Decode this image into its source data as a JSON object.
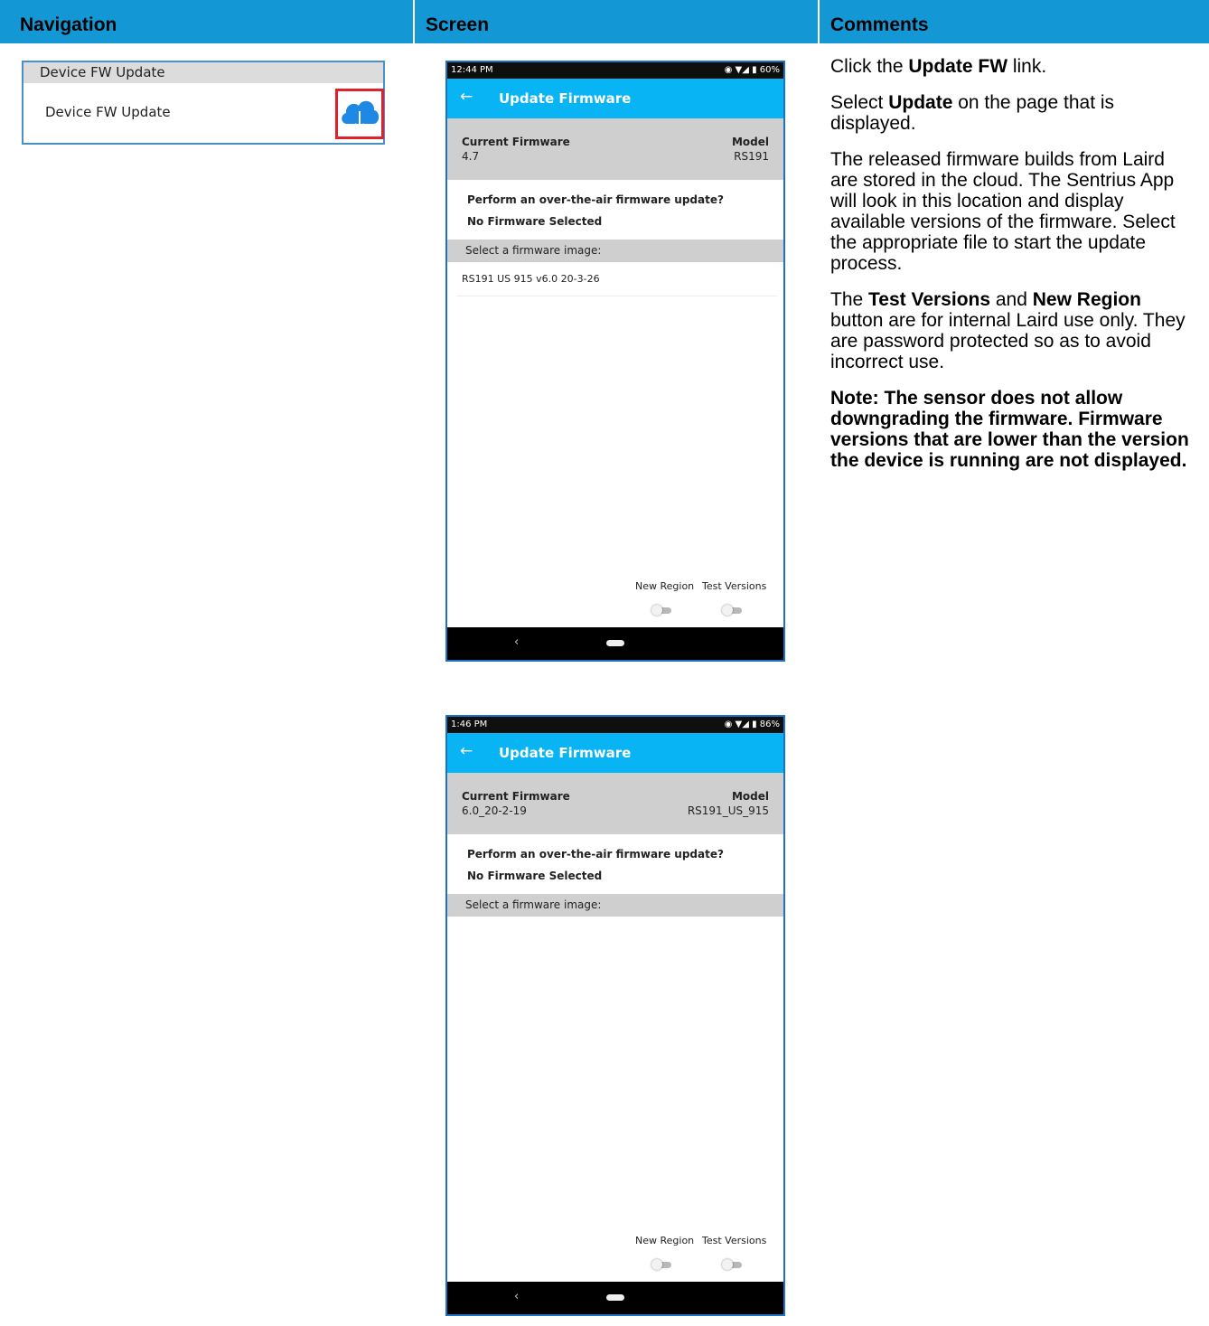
{
  "table_header": {
    "col1": "Navigation",
    "col2": "Screen",
    "col3": "Comments",
    "background": "#1498d5"
  },
  "navigation": {
    "heading": "Device FW Update",
    "item_label": "Device FW Update",
    "icon": "cloud-download-icon",
    "highlight_color": "#e0202a"
  },
  "screens": [
    {
      "status_time": "12:44 PM",
      "status_right": "◉ ▼◢ ▮ 60%",
      "title": "Update Firmware",
      "current_firmware_label": "Current Firmware",
      "current_firmware_value": "4.7",
      "model_label": "Model",
      "model_value": "RS191",
      "question": "Perform an over-the-air firmware update?",
      "no_selection": "No Firmware Selected",
      "select_prompt": "Select a firmware image:",
      "firmware_items": [
        "RS191 US 915 v6.0 20-3-26"
      ],
      "toggle_new_region": "New Region",
      "toggle_test_versions": "Test Versions"
    },
    {
      "status_time": "1:46 PM",
      "status_right": "◉ ▼◢ ▮ 86%",
      "title": "Update Firmware",
      "current_firmware_label": "Current Firmware",
      "current_firmware_value": "6.0_20-2-19",
      "model_label": "Model",
      "model_value": "RS191_US_915",
      "question": "Perform an over-the-air firmware update?",
      "no_selection": "No Firmware Selected",
      "select_prompt": "Select a firmware image:",
      "firmware_items": [],
      "toggle_new_region": "New Region",
      "toggle_test_versions": "Test Versions"
    }
  ],
  "comments": {
    "p1_pre": "Click the ",
    "p1_bold": "Update FW",
    "p1_post": " link.",
    "p2_pre": "Select ",
    "p2_bold": "Update",
    "p2_post": " on the page that is displayed.",
    "p3": "The released firmware builds from Laird are stored in the cloud. The Sentrius App will look in this location and display available versions of the firmware. Select the appropriate file to start the update process.",
    "p4_pre": "The ",
    "p4_bold1": "Test Versions",
    "p4_mid": " and ",
    "p4_bold2": "New Region",
    "p4_post": " button are for internal Laird use only. They are password protected so as to avoid incorrect use.",
    "note": "Note: The sensor does not allow downgrading the firmware. Firmware versions that are lower than the version the device is running are not displayed."
  }
}
